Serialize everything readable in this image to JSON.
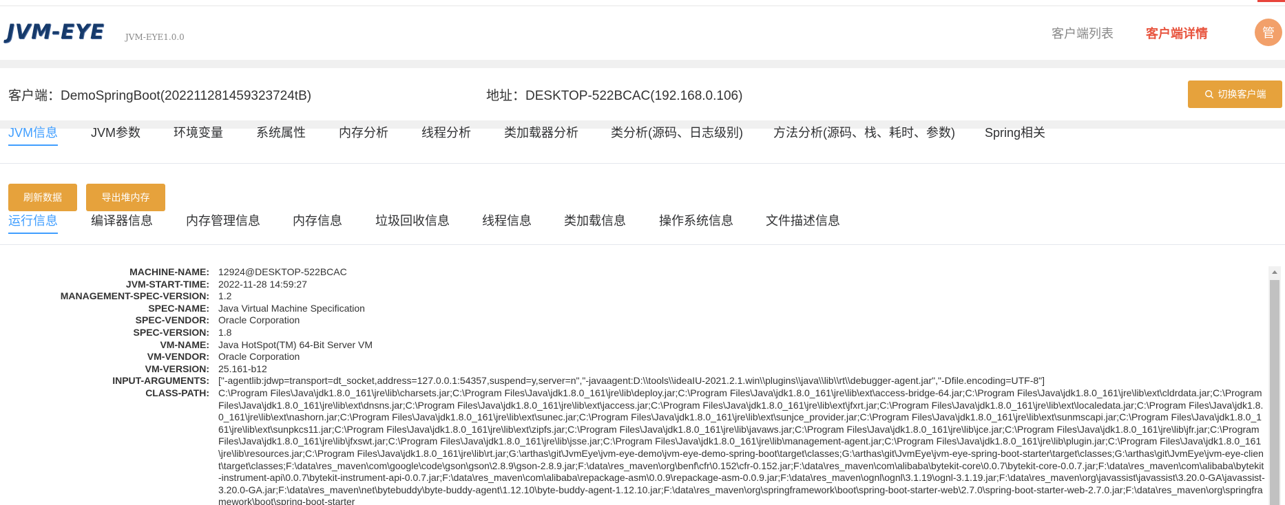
{
  "app": {
    "logo": "JVM-EYE",
    "version": "JVM-EYE1.0.0",
    "nav_client_list": "客户端列表",
    "nav_client_detail": "客户端详情",
    "avatar": "管"
  },
  "info": {
    "client": "客户端：DemoSpringBoot(202211281459323724tB)",
    "address": "地址：DESKTOP-522BCAC(192.168.0.106)",
    "switch_button": "切换客户端",
    "switch_icon": "search-icon"
  },
  "main_tabs": [
    "JVM信息",
    "JVM参数",
    "环境变量",
    "系统属性",
    "内存分析",
    "线程分析",
    "类加载器分析",
    "类分析(源码、日志级别)",
    "方法分析(源码、栈、耗时、参数)",
    "Spring相关"
  ],
  "actions": {
    "refresh": "刷新数据",
    "export_heap": "导出堆内存"
  },
  "sub_tabs": [
    "运行信息",
    "编译器信息",
    "内存管理信息",
    "内存信息",
    "垃圾回收信息",
    "线程信息",
    "类加载信息",
    "操作系统信息",
    "文件描述信息"
  ],
  "properties": [
    {
      "key": "MACHINE-NAME:",
      "value": "12924@DESKTOP-522BCAC"
    },
    {
      "key": "JVM-START-TIME:",
      "value": "2022-11-28 14:59:27"
    },
    {
      "key": "MANAGEMENT-SPEC-VERSION:",
      "value": "1.2"
    },
    {
      "key": "SPEC-NAME:",
      "value": "Java Virtual Machine Specification"
    },
    {
      "key": "SPEC-VENDOR:",
      "value": "Oracle Corporation"
    },
    {
      "key": "SPEC-VERSION:",
      "value": "1.8"
    },
    {
      "key": "VM-NAME:",
      "value": "Java HotSpot(TM) 64-Bit Server VM"
    },
    {
      "key": "VM-VENDOR:",
      "value": "Oracle Corporation"
    },
    {
      "key": "VM-VERSION:",
      "value": "25.161-b12"
    },
    {
      "key": "INPUT-ARGUMENTS:",
      "value": "[\"-agentlib:jdwp=transport=dt_socket,address=127.0.0.1:54357,suspend=y,server=n\",\"-javaagent:D:\\\\tools\\\\ideaIU-2021.2.1.win\\\\plugins\\\\java\\\\lib\\\\rt\\\\debugger-agent.jar\",\"-Dfile.encoding=UTF-8\"]"
    },
    {
      "key": "CLASS-PATH:",
      "value": "C:\\Program Files\\Java\\jdk1.8.0_161\\jre\\lib\\charsets.jar;C:\\Program Files\\Java\\jdk1.8.0_161\\jre\\lib\\deploy.jar;C:\\Program Files\\Java\\jdk1.8.0_161\\jre\\lib\\ext\\access-bridge-64.jar;C:\\Program Files\\Java\\jdk1.8.0_161\\jre\\lib\\ext\\cldrdata.jar;C:\\Program Files\\Java\\jdk1.8.0_161\\jre\\lib\\ext\\dnsns.jar;C:\\Program Files\\Java\\jdk1.8.0_161\\jre\\lib\\ext\\jaccess.jar;C:\\Program Files\\Java\\jdk1.8.0_161\\jre\\lib\\ext\\jfxrt.jar;C:\\Program Files\\Java\\jdk1.8.0_161\\jre\\lib\\ext\\localedata.jar;C:\\Program Files\\Java\\jdk1.8.0_161\\jre\\lib\\ext\\nashorn.jar;C:\\Program Files\\Java\\jdk1.8.0_161\\jre\\lib\\ext\\sunec.jar;C:\\Program Files\\Java\\jdk1.8.0_161\\jre\\lib\\ext\\sunjce_provider.jar;C:\\Program Files\\Java\\jdk1.8.0_161\\jre\\lib\\ext\\sunmscapi.jar;C:\\Program Files\\Java\\jdk1.8.0_161\\jre\\lib\\ext\\sunpkcs11.jar;C:\\Program Files\\Java\\jdk1.8.0_161\\jre\\lib\\ext\\zipfs.jar;C:\\Program Files\\Java\\jdk1.8.0_161\\jre\\lib\\javaws.jar;C:\\Program Files\\Java\\jdk1.8.0_161\\jre\\lib\\jce.jar;C:\\Program Files\\Java\\jdk1.8.0_161\\jre\\lib\\jfr.jar;C:\\Program Files\\Java\\jdk1.8.0_161\\jre\\lib\\jfxswt.jar;C:\\Program Files\\Java\\jdk1.8.0_161\\jre\\lib\\jsse.jar;C:\\Program Files\\Java\\jdk1.8.0_161\\jre\\lib\\management-agent.jar;C:\\Program Files\\Java\\jdk1.8.0_161\\jre\\lib\\plugin.jar;C:\\Program Files\\Java\\jdk1.8.0_161\\jre\\lib\\resources.jar;C:\\Program Files\\Java\\jdk1.8.0_161\\jre\\lib\\rt.jar;G:\\arthas\\git\\JvmEye\\jvm-eye-demo\\jvm-eye-demo-spring-boot\\target\\classes;G:\\arthas\\git\\JvmEye\\jvm-eye-spring-boot-starter\\target\\classes;G:\\arthas\\git\\JvmEye\\jvm-eye-client\\target\\classes;F:\\data\\res_maven\\com\\google\\code\\gson\\gson\\2.8.9\\gson-2.8.9.jar;F:\\data\\res_maven\\org\\benf\\cfr\\0.152\\cfr-0.152.jar;F:\\data\\res_maven\\com\\alibaba\\bytekit-core\\0.0.7\\bytekit-core-0.0.7.jar;F:\\data\\res_maven\\com\\alibaba\\bytekit-instrument-api\\0.0.7\\bytekit-instrument-api-0.0.7.jar;F:\\data\\res_maven\\com\\alibaba\\repackage-asm\\0.0.9\\repackage-asm-0.0.9.jar;F:\\data\\res_maven\\ognl\\ognl\\3.1.19\\ognl-3.1.19.jar;F:\\data\\res_maven\\org\\javassist\\javassist\\3.20.0-GA\\javassist-3.20.0-GA.jar;F:\\data\\res_maven\\net\\bytebuddy\\byte-buddy-agent\\1.12.10\\byte-buddy-agent-1.12.10.jar;F:\\data\\res_maven\\org\\springframework\\boot\\spring-boot-starter-web\\2.7.0\\spring-boot-starter-web-2.7.0.jar;F:\\data\\res_maven\\org\\springframework\\boot\\spring-boot-starter"
    }
  ]
}
